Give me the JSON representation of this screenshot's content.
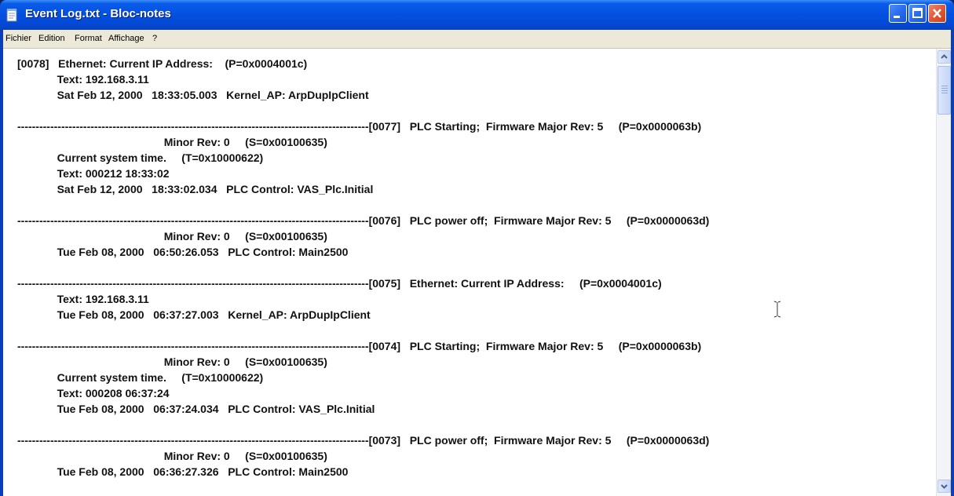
{
  "window": {
    "title": "Event Log.txt - Bloc-notes",
    "icon": "notepad-icon"
  },
  "title_controls": [
    "minimize-icon",
    "maximize-icon",
    "close-icon"
  ],
  "menu": [
    {
      "label": "Fichier"
    },
    {
      "label": "Edition"
    },
    {
      "label": "Format"
    },
    {
      "label": "Affichage"
    },
    {
      "label": "?"
    }
  ],
  "document": {
    "lines": [
      "[0078]   Ethernet: Current IP Address:    (P=0x0004001c)",
      "             Text: 192.168.3.11",
      "             Sat Feb 12, 2000   18:33:05.003   Kernel_AP: ArpDupIpClient",
      "",
      "------------------------------------------------------------------------------------------------[0077]   PLC Starting;  Firmware Major Rev: 5     (P=0x0000063b)",
      "                                                Minor Rev: 0     (S=0x00100635)",
      "             Current system time.     (T=0x10000622)",
      "             Text: 000212 18:33:02",
      "             Sat Feb 12, 2000   18:33:02.034   PLC Control: VAS_Plc.Initial",
      "",
      "------------------------------------------------------------------------------------------------[0076]   PLC power off;  Firmware Major Rev: 5     (P=0x0000063d)",
      "                                                Minor Rev: 0     (S=0x00100635)",
      "             Tue Feb 08, 2000   06:50:26.053   PLC Control: Main2500",
      "",
      "------------------------------------------------------------------------------------------------[0075]   Ethernet: Current IP Address:     (P=0x0004001c)",
      "             Text: 192.168.3.11",
      "             Tue Feb 08, 2000   06:37:27.003   Kernel_AP: ArpDupIpClient",
      "",
      "------------------------------------------------------------------------------------------------[0074]   PLC Starting;  Firmware Major Rev: 5     (P=0x0000063b)",
      "                                                Minor Rev: 0     (S=0x00100635)",
      "             Current system time.     (T=0x10000622)",
      "             Text: 000208 06:37:24",
      "             Tue Feb 08, 2000   06:37:24.034   PLC Control: VAS_Plc.Initial",
      "",
      "------------------------------------------------------------------------------------------------[0073]   PLC power off;  Firmware Major Rev: 5     (P=0x0000063d)",
      "                                                Minor Rev: 0     (S=0x00100635)",
      "             Tue Feb 08, 2000   06:36:27.326   PLC Control: Main2500"
    ]
  },
  "scrollbar": {
    "up_icon": "scroll-up-arrow-icon",
    "down_icon": "scroll-down-arrow-icon"
  },
  "colors": {
    "titlebar": "#0350df",
    "menubar": "#ece9d8",
    "close_button": "#e0573a"
  }
}
